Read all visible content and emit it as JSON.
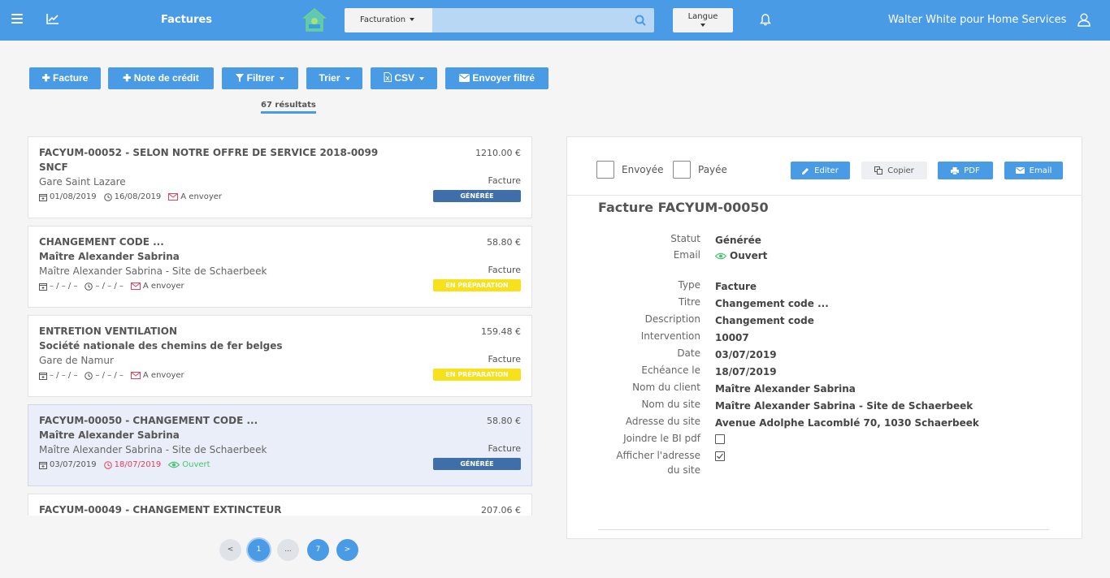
{
  "header": {
    "title": "Factures",
    "search_scope": "Facturation",
    "search_placeholder": "",
    "language_label": "Langue",
    "user_name": "Walter White pour Home Services"
  },
  "toolbar": {
    "new_invoice": "Facture",
    "credit_note": "Note de crédit",
    "filter": "Filtrer",
    "sort": "Trier",
    "csv": "CSV",
    "send_filtered": "Envoyer filtré",
    "results": "67 résultats"
  },
  "invoices": [
    {
      "title": "FACYUM-00052 - SELON NOTRE OFFRE DE SERVICE 2018-0099",
      "client": "SNCF",
      "site": "Gare Saint Lazare",
      "amount": "1210.00 €",
      "type": "Facture",
      "date": "01/08/2019",
      "due": "16/08/2019",
      "mail": "A envoyer",
      "status": "GÉNÉRÉE"
    },
    {
      "title": "CHANGEMENT CODE ...",
      "client": "Maître Alexander Sabrina",
      "site": "Maître Alexander Sabrina - Site de Schaerbeek",
      "amount": "58.80 €",
      "type": "Facture",
      "date": "– / – / –",
      "due": "– / – / –",
      "mail": "A envoyer",
      "status": "EN PRÉPARATION"
    },
    {
      "title": "ENTRETION VENTILATION",
      "client": "Société nationale des chemins de fer belges",
      "site": "Gare de Namur",
      "amount": "159.48 €",
      "type": "Facture",
      "date": "– / – / –",
      "due": "– / – / –",
      "mail": "A envoyer",
      "status": "EN PRÉPARATION"
    },
    {
      "title": "FACYUM-00050 - CHANGEMENT CODE ...",
      "client": "Maître Alexander Sabrina",
      "site": "Maître Alexander Sabrina - Site de Schaerbeek",
      "amount": "58.80 €",
      "type": "Facture",
      "date": "03/07/2019",
      "due": "18/07/2019",
      "mail": "Ouvert",
      "status": "GÉNÉRÉE"
    },
    {
      "title": "FACYUM-00049 - CHANGEMENT EXTINCTEUR",
      "amount": "207.06 €"
    }
  ],
  "pagination": {
    "prev": "<",
    "current": "1",
    "ellipsis": "...",
    "last": "7",
    "next": ">"
  },
  "detail": {
    "sent_label": "Envoyée",
    "paid_label": "Payée",
    "edit": "Editer",
    "copy": "Copier",
    "pdf": "PDF",
    "email": "Email",
    "title": "Facture FACYUM-00050",
    "fields": {
      "statut_label": "Statut",
      "statut": "Générée",
      "email_label": "Email",
      "email_value": "Ouvert",
      "type_label": "Type",
      "type": "Facture",
      "titre_label": "Titre",
      "titre": "Changement code ...",
      "description_label": "Description",
      "description": "Changement code",
      "intervention_label": "Intervention",
      "intervention": "10007",
      "date_label": "Date",
      "date": "03/07/2019",
      "echeance_label": "Echéance le",
      "echeance": "18/07/2019",
      "client_label": "Nom du client",
      "client": "Maître Alexander Sabrina",
      "site_label": "Nom du site",
      "site": "Maître Alexander Sabrina - Site de Schaerbeek",
      "address_label": "Adresse du site",
      "address": "Avenue Adolphe Lacomblé 70, 1030 Schaerbeek",
      "bi_label": "Joindre le BI pdf",
      "show_address_label_1": "Afficher l'adresse",
      "show_address_label_2": "du site"
    }
  },
  "colors": {
    "primary": "#4a9be6",
    "generated": "#3e6fa8",
    "preparation": "#f7e11b",
    "overdue": "#e0405a",
    "opened": "#45c66b"
  }
}
